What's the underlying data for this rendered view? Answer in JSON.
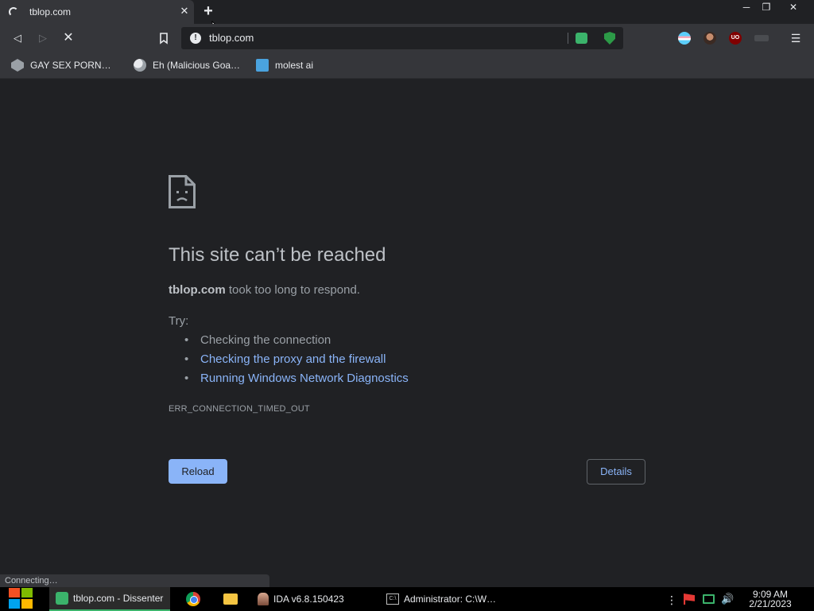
{
  "tab": {
    "title": "tblop.com",
    "close": "✕",
    "new_tab": "+"
  },
  "window_controls": {
    "minimize": "─",
    "maximize": "❐",
    "close": "✕"
  },
  "toolbar": {
    "back": "◁",
    "forward": "▷",
    "stop": "✕",
    "bookmark": "🔖",
    "url": "tblop.com",
    "info": "!",
    "ublock": "UO",
    "menu": "☰"
  },
  "bookmarks": [
    {
      "label": "GAY SEX PORN…"
    },
    {
      "label": "Eh (Malicious Goa…"
    },
    {
      "label": "molest ai"
    }
  ],
  "error": {
    "title": "This site can’t be reached",
    "host": "tblop.com",
    "desc_suffix": " took too long to respond.",
    "try_label": "Try:",
    "suggestions": [
      "Checking the connection",
      "Checking the proxy and the firewall",
      "Running Windows Network Diagnostics"
    ],
    "code": "ERR_CONNECTION_TIMED_OUT",
    "reload_label": "Reload",
    "details_label": "Details"
  },
  "status_text": "Connecting…",
  "taskbar": {
    "items": [
      {
        "label": "tblop.com - Dissenter"
      },
      {
        "label": "IDA v6.8.150423"
      },
      {
        "label": "Administrator: C:\\W…"
      }
    ],
    "cmd_icon": "C:\\",
    "tray_dots": "⋮",
    "volume": "🔊",
    "clock_time": "9:09 AM",
    "clock_date": "2/21/2023"
  }
}
